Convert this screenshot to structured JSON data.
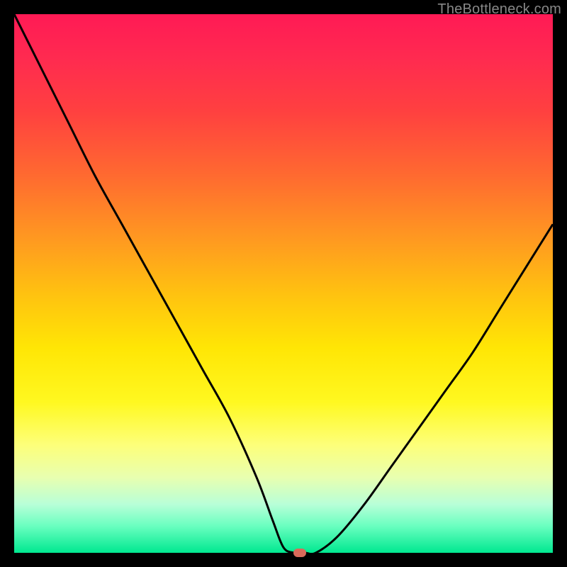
{
  "watermark": "TheBottleneck.com",
  "chart_data": {
    "type": "line",
    "title": "",
    "xlabel": "",
    "ylabel": "",
    "xlim": [
      0,
      100
    ],
    "ylim": [
      0,
      100
    ],
    "background_gradient": {
      "direction": "vertical",
      "stops": [
        {
          "pos": 0,
          "color": "#ff1a55"
        },
        {
          "pos": 18,
          "color": "#ff4040"
        },
        {
          "pos": 42,
          "color": "#ff9a20"
        },
        {
          "pos": 62,
          "color": "#ffe605"
        },
        {
          "pos": 80,
          "color": "#fdff7a"
        },
        {
          "pos": 100,
          "color": "#00e890"
        }
      ]
    },
    "series": [
      {
        "name": "bottleneck-curve",
        "x": [
          0,
          5,
          10,
          15,
          20,
          25,
          30,
          35,
          40,
          45,
          48,
          50,
          52,
          54,
          56,
          60,
          65,
          70,
          75,
          80,
          85,
          90,
          95,
          100
        ],
        "y": [
          100,
          90,
          80,
          70,
          61,
          52,
          43,
          34,
          25,
          14,
          6,
          1,
          0,
          0,
          0,
          3,
          9,
          16,
          23,
          30,
          37,
          45,
          53,
          61
        ]
      }
    ],
    "marker": {
      "x": 53,
      "y": 0,
      "color": "#d96a5a"
    }
  }
}
